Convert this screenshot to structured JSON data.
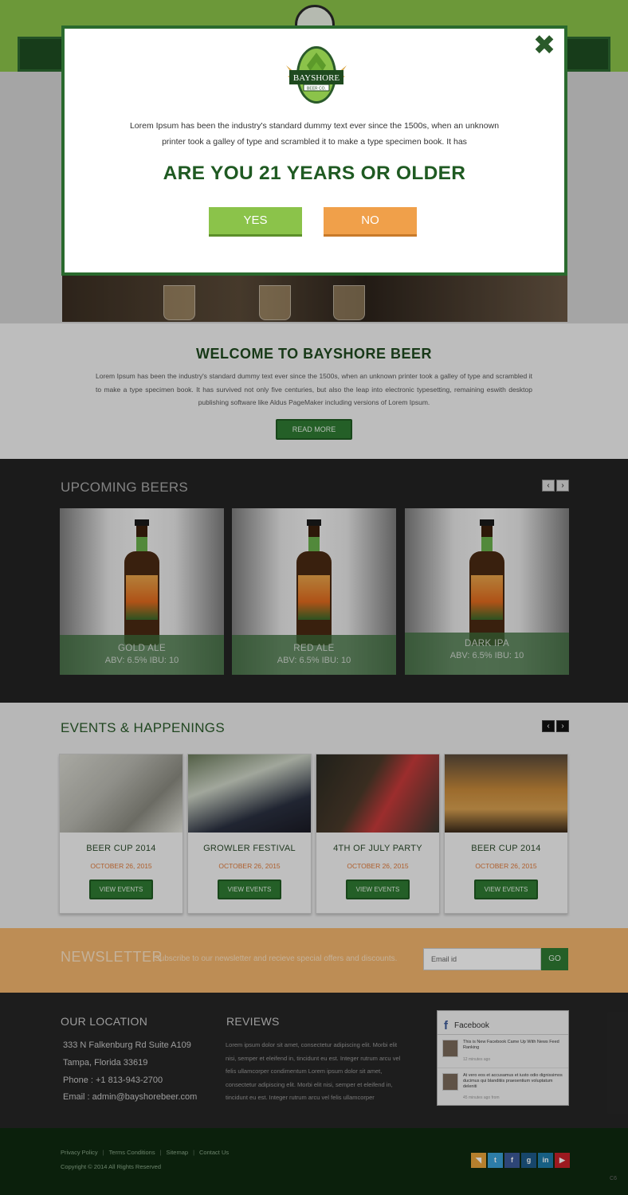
{
  "modal": {
    "logo_text": "BAYSHORE",
    "logo_subtext": "BEER CO.",
    "text": "Lorem Ipsum has been the industry's standard dummy text ever since the 1500s, when an unknown printer took a galley of type and scrambled it to make a type specimen book. It has",
    "question": "ARE YOU 21 YEARS OR OLDER",
    "yes_label": "YES",
    "no_label": "NO",
    "close_icon": "close-icon"
  },
  "welcome": {
    "title": "WELCOME TO BAYSHORE BEER",
    "text": "Lorem Ipsum has been the industry's standard dummy text ever since the 1500s, when an unknown printer took a galley of type and scrambled it to make a type specimen book. It has survived not only five centuries, but also the leap into electronic typesetting, remaining eswith desktop publishing software like Aldus PageMaker including versions of Lorem Ipsum.",
    "button_label": "READ MORE"
  },
  "beers": {
    "title": "UPCOMING BEERS",
    "prev_icon": "‹",
    "next_icon": "›",
    "items": [
      {
        "name": "GOLD ALE",
        "abv": "ABV: 6.5% IBU: 10"
      },
      {
        "name": "RED ALE",
        "abv": "ABV: 6.5% IBU: 10"
      },
      {
        "name": "DARK IPA",
        "abv": "ABV: 6.5% IBU: 10"
      }
    ]
  },
  "events": {
    "title": "EVENTS & HAPPENINGS",
    "prev_icon": "‹",
    "next_icon": "›",
    "items": [
      {
        "title": "BEER CUP 2014",
        "date": "OCTOBER 26, 2015",
        "button": "VIEW EVENTS"
      },
      {
        "title": "GROWLER FESTIVAL",
        "date": "OCTOBER 26, 2015",
        "button": "VIEW EVENTS"
      },
      {
        "title": "4TH OF JULY PARTY",
        "date": "OCTOBER 26, 2015",
        "button": "VIEW EVENTS"
      },
      {
        "title": "BEER CUP 2014",
        "date": "OCTOBER 26, 2015",
        "button": "VIEW EVENTS"
      }
    ]
  },
  "newsletter": {
    "title": "NEWSLETTER",
    "text": "Subscribe to our newsletter and recieve special offers and discounts.",
    "input_placeholder": "Email id",
    "button_label": "GO"
  },
  "location": {
    "title": "OUR LOCATION",
    "address1": "333 N Falkenburg Rd Suite A109",
    "address2": "Tampa, Florida 33619",
    "phone": "Phone : +1 813-943-2700",
    "email": "Email : admin@bayshorebeer.com"
  },
  "reviews": {
    "title": "REVIEWS",
    "text": "Lorem ipsum dolor sit amet, consectetur adipiscing elit. Morbi elit nisi, semper et eleifend in, tincidunt eu est. Integer rutrum arcu vel felis ullamcorper condimentum Lorem ipsum dolor sit amet, consectetur adipiscing elit. Morbi elit nisi, semper et eleifend in, tincidunt eu est. Integer rutrum arcu vel felis ullamcorper"
  },
  "facebook": {
    "title": "Facebook",
    "posts": [
      {
        "text": "This is New Facebook Came Up With News Feed Ranking",
        "time": "12 minutes ago"
      },
      {
        "text": "At vero eos et accusamus et iusto odio dignissimos ducimus qui blanditiis praesentium voluptatum deleniti",
        "time": "45 minutes ago from"
      }
    ]
  },
  "footer": {
    "links": [
      "Privacy Policy",
      "Terms Conditions",
      "Sitemap",
      "Contact Us"
    ],
    "separator": "|",
    "copyright": "Copyright © 2014  All Rights Reserved",
    "social": [
      {
        "name": "rss-icon",
        "glyph": "◥",
        "color": "#e8a33a"
      },
      {
        "name": "twitter-icon",
        "glyph": "t",
        "color": "#3aa0d8"
      },
      {
        "name": "facebook-icon",
        "glyph": "f",
        "color": "#3b5998"
      },
      {
        "name": "google-plus-icon",
        "glyph": "g",
        "color": "#1e5a8a"
      },
      {
        "name": "linkedin-icon",
        "glyph": "in",
        "color": "#1e7aa8"
      },
      {
        "name": "youtube-icon",
        "glyph": "▶",
        "color": "#c8202a"
      }
    ],
    "corner_mark": "C6"
  },
  "colors": {
    "brand_green": "#2f7a32",
    "accent_orange": "#f0a04a",
    "header_green": "#8bc34a"
  }
}
